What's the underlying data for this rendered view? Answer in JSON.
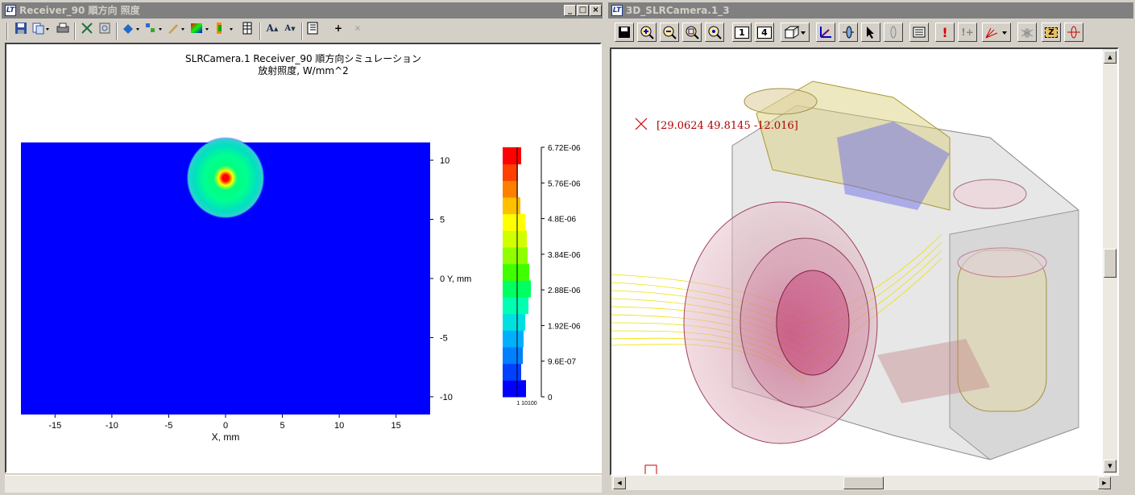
{
  "left_window": {
    "title": "Receiver_90 順方向 照度",
    "app_icon": "LT",
    "controls": [
      "_",
      "□",
      "×"
    ],
    "toolbar_icons": [
      "save-icon",
      "copy-icon",
      "print-icon",
      "fit-icon",
      "zoom-icon",
      "color-icon",
      "chart-icon",
      "pen-icon",
      "palette-icon",
      "contour-icon",
      "columns-icon",
      "font-increase-icon",
      "font-decrease-icon",
      "report-icon",
      "plus-icon",
      "close-small-icon"
    ],
    "toolbar_text": {
      "font_up": "A",
      "font_down": "A",
      "plus": "+",
      "x": "×"
    },
    "chart": {
      "title_line1": "SLRCamera.1 Receiver_90 順方向シミュレーション",
      "title_line2": "放射照度, W/mm^2"
    },
    "colorbar": {
      "ticks": [
        "6.72E-06",
        "5.76E-06",
        "4.8E-06",
        "3.84E-06",
        "2.88E-06",
        "1.92E-06",
        "9.6E-07",
        "0"
      ],
      "hist_label": "1 10100"
    }
  },
  "chart_data": {
    "type": "heatmap",
    "title": "SLRCamera.1 Receiver_90 順方向シミュレーション",
    "subtitle": "放射照度, W/mm^2",
    "xlabel": "X, mm",
    "ylabel": "Y, mm",
    "xlim": [
      -18,
      18
    ],
    "ylim": [
      -11.5,
      11.5
    ],
    "x_ticks": [
      -15,
      -10,
      -5,
      0,
      5,
      10,
      15
    ],
    "y_ticks": [
      10,
      5,
      0,
      -5,
      -10
    ],
    "x_tick_labels": [
      "-15",
      "-10",
      "-5",
      "0",
      "5",
      "10",
      "15"
    ],
    "y_tick_labels": [
      "10",
      "5",
      "0 Y, mm",
      "-5",
      "-10"
    ],
    "spot_center": [
      0,
      8.5
    ],
    "spot_radius_mm": 3.3,
    "peak_value": 6.72e-06,
    "colorbar_range": [
      0,
      6.72e-06
    ],
    "colors": {
      "background": "#0000ff",
      "low": "#00ff80",
      "peak": "#ff0000"
    }
  },
  "right_window": {
    "title": "3D_SLRCamera.1_3",
    "app_icon": "LT",
    "toolbar_icons": [
      "save-icon",
      "zoom-in-icon",
      "zoom-out-icon",
      "zoom-window-icon",
      "zoom-fit-icon",
      "view-1-icon",
      "view-4-icon",
      "view-cube-icon",
      "axes-icon",
      "lens-icon",
      "pointer-icon",
      "dim-icon",
      "report-icon",
      "exclamation-icon",
      "flag-icon",
      "ray-icon",
      "bug-icon",
      "zbox-icon",
      "spin-icon"
    ],
    "toolbar_text": {
      "view1": "1",
      "view4": "4",
      "zbox": "Z",
      "warn": "!",
      "flag": "!+"
    },
    "coordinate_readout": "[29.0624 49.8145 -12.016]"
  }
}
